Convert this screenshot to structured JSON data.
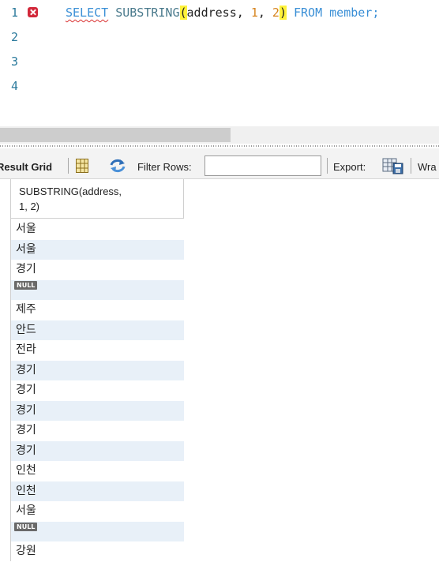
{
  "editor": {
    "line_numbers": [
      "1",
      "2",
      "3",
      "4"
    ],
    "sql": {
      "select_kw": "SELECT",
      "func": "SUBSTRING",
      "open_paren": "(",
      "arg_col": "address, ",
      "arg1": "1",
      "comma": ", ",
      "arg2": "2",
      "close_paren": ")",
      "from_kw": "FROM",
      "table": "member;"
    }
  },
  "toolbar": {
    "title": "Result Grid",
    "filter_label": "Filter Rows:",
    "filter_value": "",
    "export_label": "Export:",
    "wrap_label": "Wra"
  },
  "grid": {
    "column_header_line1": "SUBSTRING(address,",
    "column_header_line2": "1, 2)",
    "rows": [
      "서울",
      "서울",
      "경기",
      "NULL",
      "제주",
      "안드",
      "전라",
      "경기",
      "경기",
      "경기",
      "경기",
      "경기",
      "인천",
      "인천",
      "서울",
      "NULL",
      "강원"
    ]
  },
  "colors": {
    "keyword": "#3a8fd6",
    "number": "#d7841e",
    "paren_highlight": "#fff23a",
    "error": "#d2283a",
    "alt_row": "#e8f0f8"
  }
}
